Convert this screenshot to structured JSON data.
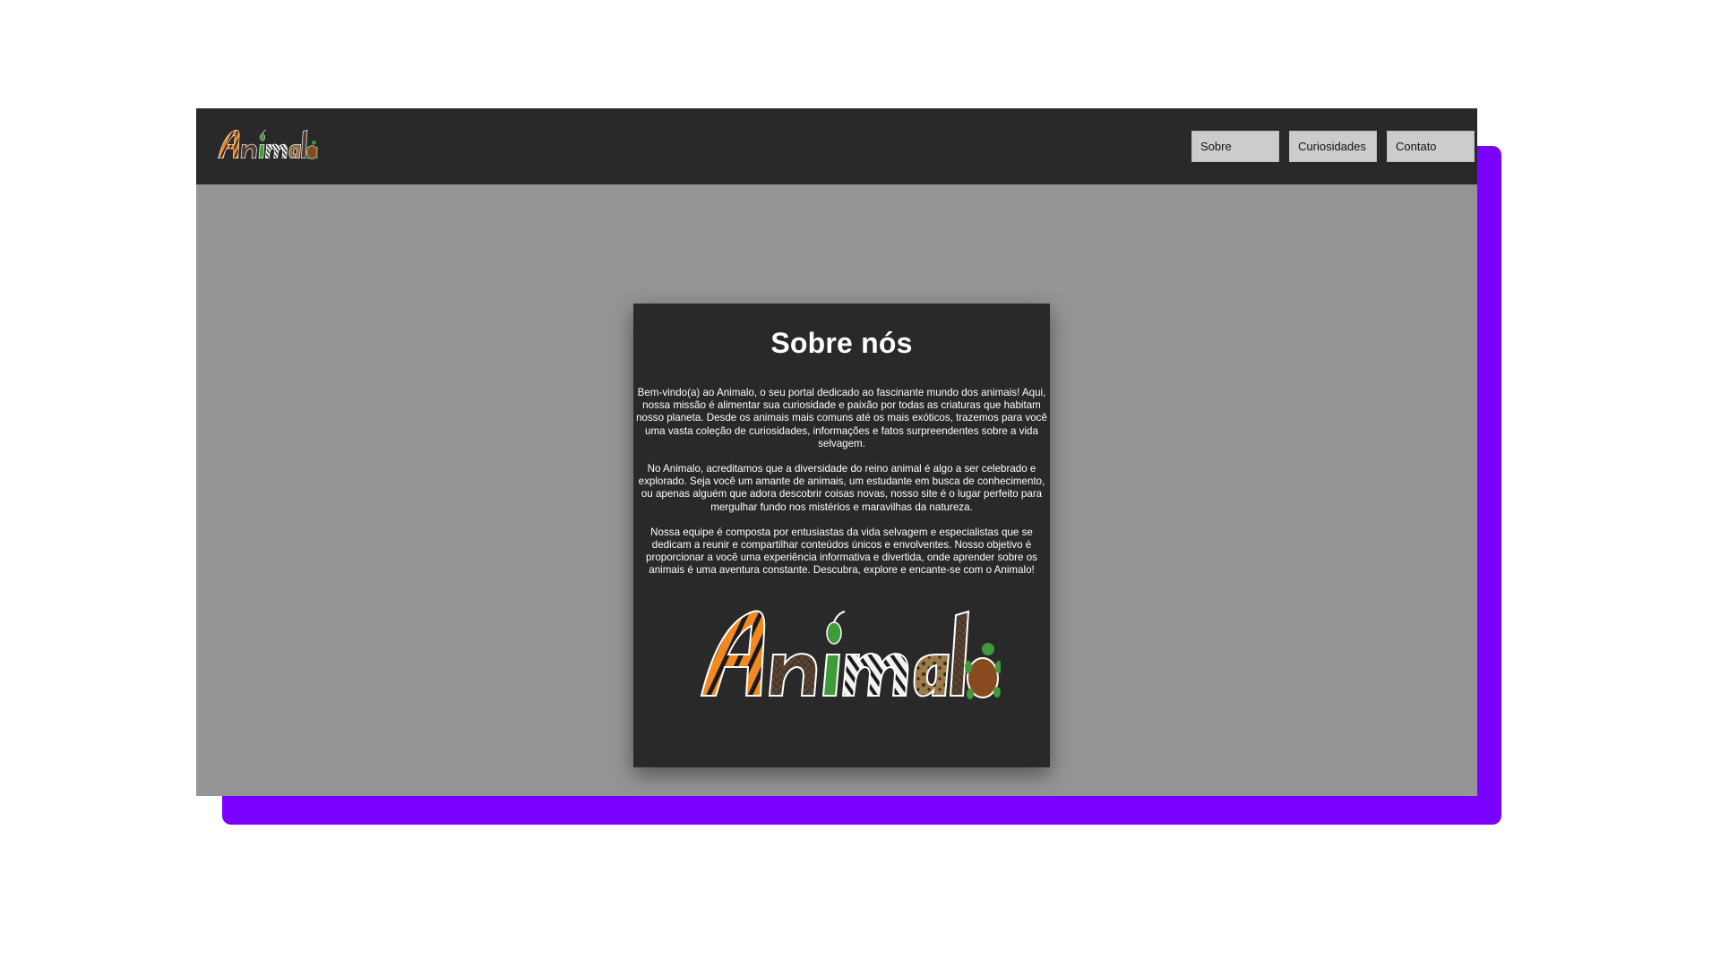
{
  "brand": {
    "logo_text": "Animalo"
  },
  "nav": {
    "items": [
      {
        "label": "Sobre"
      },
      {
        "label": "Curiosidades"
      },
      {
        "label": "Contato"
      }
    ]
  },
  "about": {
    "title": "Sobre nós",
    "paragraphs": [
      "Bem-vindo(a) ao Animalo, o seu portal dedicado ao fascinante mundo dos animais! Aqui, nossa missão é alimentar sua curiosidade e paixão por todas as criaturas que habitam nosso planeta. Desde os animais mais comuns até os mais exóticos, trazemos para você uma vasta coleção de curiosidades, informações e fatos surpreendentes sobre a vida selvagem.",
      "No Animalo, acreditamos que a diversidade do reino animal é algo a ser celebrado e explorado. Seja você um amante de animais, um estudante em busca de conhecimento, ou apenas alguém que adora descobrir coisas novas, nosso site é o lugar perfeito para mergulhar fundo nos mistérios e maravilhas da natureza.",
      "Nossa equipe é composta por entusiastas da vida selvagem e especialistas que se dedicam a reunir e compartilhar conteúdos únicos e envolventes. Nosso objetivo é proporcionar a você uma experiência informativa e divertida, onde aprender sobre os animais é uma aventura constante. Descubra, explore e encante-se com o Animalo!"
    ]
  },
  "colors": {
    "accent_purple": "#7a00ff",
    "navbar": "#292929",
    "page_bg": "#959595",
    "card_bg": "#292929",
    "button_bg": "#cccccc",
    "tiger_orange": "#f2891e",
    "leaf_green": "#3f9a3a",
    "turtle_brown": "#8a4a1f"
  }
}
